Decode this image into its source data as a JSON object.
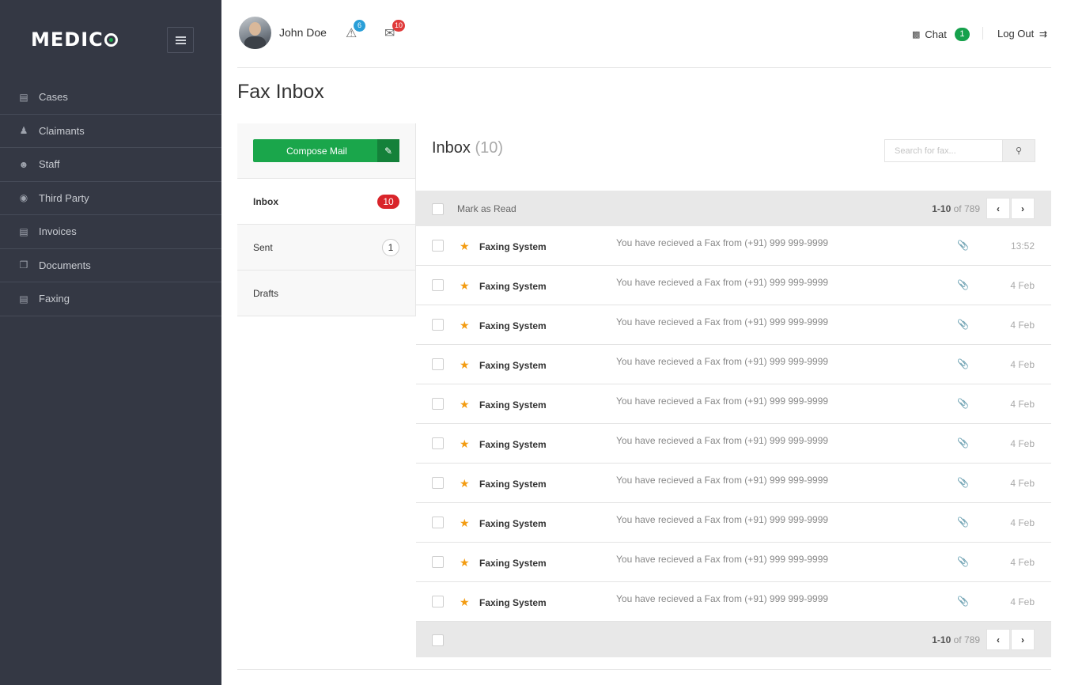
{
  "sidebar": {
    "logo": "MEDICO",
    "items": [
      {
        "label": "Cases",
        "icon": "list-icon"
      },
      {
        "label": "Claimants",
        "icon": "users-icon"
      },
      {
        "label": "Staff",
        "icon": "user-icon"
      },
      {
        "label": "Third Party",
        "icon": "eye-icon"
      },
      {
        "label": "Invoices",
        "icon": "document-icon"
      },
      {
        "label": "Documents",
        "icon": "files-icon"
      },
      {
        "label": "Faxing",
        "icon": "book-icon"
      }
    ]
  },
  "topbar": {
    "user_name": "John Doe",
    "alerts_count": "6",
    "messages_count": "10",
    "chat_label": "Chat",
    "chat_count": "1",
    "logout_label": "Log Out"
  },
  "page": {
    "title": "Fax Inbox"
  },
  "mailnav": {
    "compose_label": "Compose Mail",
    "folders": [
      {
        "label": "Inbox",
        "count": "10"
      },
      {
        "label": "Sent",
        "count": "1"
      },
      {
        "label": "Drafts",
        "count": ""
      }
    ]
  },
  "inbox": {
    "title": "Inbox",
    "count_label": "(10)",
    "search_placeholder": "Search for fax...",
    "mark_read_label": "Mark as Read",
    "pager_range": "1-10",
    "pager_total": "of 789",
    "messages": [
      {
        "sender": "Faxing System",
        "subject": "You have recieved a Fax from (+91) 999 999-9999",
        "date": "13:52"
      },
      {
        "sender": "Faxing System",
        "subject": "You have recieved a Fax from (+91) 999 999-9999",
        "date": "4 Feb"
      },
      {
        "sender": "Faxing System",
        "subject": "You have recieved a Fax from (+91) 999 999-9999",
        "date": "4 Feb"
      },
      {
        "sender": "Faxing System",
        "subject": "You have recieved a Fax from (+91) 999 999-9999",
        "date": "4 Feb"
      },
      {
        "sender": "Faxing System",
        "subject": "You have recieved a Fax from (+91) 999 999-9999",
        "date": "4 Feb"
      },
      {
        "sender": "Faxing System",
        "subject": "You have recieved a Fax from (+91) 999 999-9999",
        "date": "4 Feb"
      },
      {
        "sender": "Faxing System",
        "subject": "You have recieved a Fax from (+91) 999 999-9999",
        "date": "4 Feb"
      },
      {
        "sender": "Faxing System",
        "subject": "You have recieved a Fax from (+91) 999 999-9999",
        "date": "4 Feb"
      },
      {
        "sender": "Faxing System",
        "subject": "You have recieved a Fax from (+91) 999 999-9999",
        "date": "4 Feb"
      },
      {
        "sender": "Faxing System",
        "subject": "You have recieved a Fax from (+91) 999 999-9999",
        "date": "4 Feb"
      }
    ]
  },
  "colors": {
    "sidebar_bg": "#343844",
    "brand_green": "#1aa64b",
    "badge_red": "#d9242a",
    "badge_blue": "#2a9fd8",
    "star_orange": "#f39c12"
  }
}
